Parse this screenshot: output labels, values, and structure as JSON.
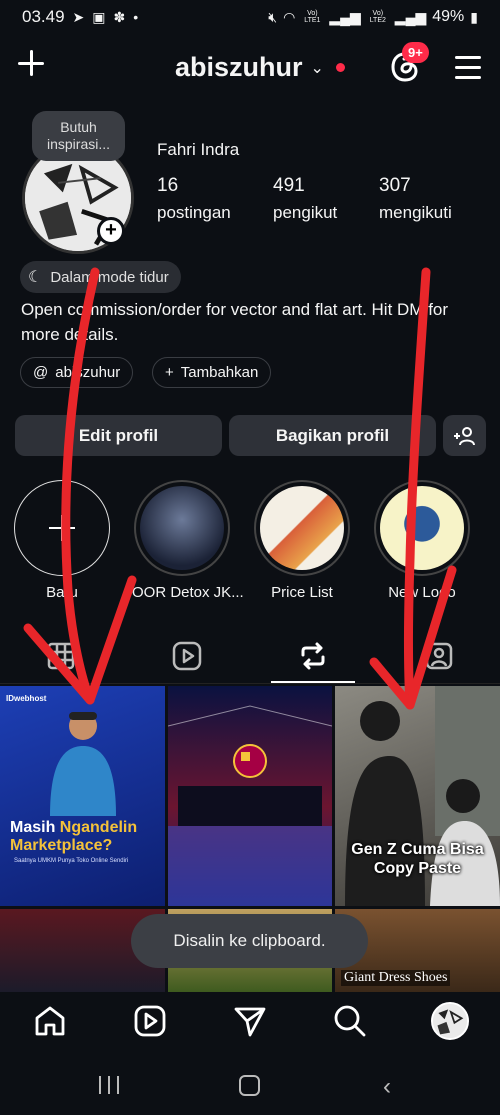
{
  "statusbar": {
    "time": "03.49",
    "battery": "49%",
    "sim1": "Vo) LTE1",
    "sim2": "Vo) LTE2"
  },
  "header": {
    "username": "abiszuhur",
    "notification_badge": "9+"
  },
  "profile": {
    "note": "Butuh inspirasi...",
    "display_name": "Fahri Indra",
    "posts_count": "16",
    "posts_label": "postingan",
    "followers_count": "491",
    "followers_label": "pengikut",
    "following_count": "307",
    "following_label": "mengikuti",
    "status": "Dalam mode tidur",
    "bio": "Open commission/order for vector and flat art. Hit DM for more details.",
    "threads_link": "abiszuhur",
    "add_link_label": "Tambahkan"
  },
  "actions": {
    "edit_profile": "Edit profil",
    "share_profile": "Bagikan profil"
  },
  "highlights": [
    {
      "label": "Baru"
    },
    {
      "label": "OOR Detox JK..."
    },
    {
      "label": "Price List"
    },
    {
      "label": "New Logo"
    }
  ],
  "tabs": {
    "active": "reposts"
  },
  "posts": {
    "ad_brand": "IDwebhost",
    "ad_title_line1": "Masih",
    "ad_title_highlight": "Ngandelin",
    "ad_title_line2": "Marketplace?",
    "ad_subtitle": "Saatnya UMKM Punya Toko Online Sendiri",
    "genz_caption": "Gen Z Cuma Bisa Copy Paste",
    "shoes_caption": "Giant Dress Shoes"
  },
  "toast": "Disalin ke clipboard.",
  "colors": {
    "background": "#0c0f14",
    "accent_red": "#ff2b49",
    "button_bg": "#2e3138",
    "annotation_arrow": "#e8262a"
  }
}
